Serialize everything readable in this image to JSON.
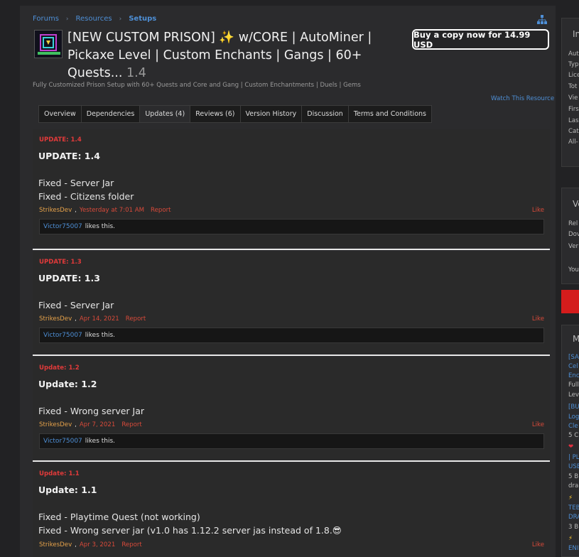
{
  "breadcrumb": {
    "forums": "Forums",
    "resources": "Resources",
    "setups": "Setups"
  },
  "resource": {
    "title": "[NEW CUSTOM PRISON] ✨ w/CORE | AutoMiner | Pickaxe Level | Custom Enchants | Gangs | 60+ Quests...",
    "version": "1.4",
    "tagline": "Fully Customized Prison Setup with 60+ Quests and Core and Gang | Custom Enchantments | Duels | Gems",
    "buy_label": "Buy a copy now for 14.99 USD",
    "watch_label": "Watch This Resource"
  },
  "tabs": [
    {
      "label": "Overview"
    },
    {
      "label": "Dependencies"
    },
    {
      "label": "Updates (4)"
    },
    {
      "label": "Reviews (6)"
    },
    {
      "label": "Version History"
    },
    {
      "label": "Discussion"
    },
    {
      "label": "Terms and Conditions"
    }
  ],
  "updates": [
    {
      "small_title": "UPDATE: 1.4",
      "title": "UPDATE: 1.4",
      "lines": [
        "Fixed - Server Jar",
        "Fixed - Citizens folder"
      ],
      "author": "StrikesDev",
      "date": "Yesterday at 7:01 AM",
      "report": "Report",
      "like": "Like",
      "liker": "Victor75007",
      "likes_text": "likes this."
    },
    {
      "small_title": "UPDATE: 1.3",
      "title": "UPDATE: 1.3",
      "lines": [
        "Fixed - Server Jar"
      ],
      "author": "StrikesDev",
      "date": "Apr 14, 2021",
      "report": "Report",
      "like": "Like",
      "liker": "Victor75007",
      "likes_text": "likes this."
    },
    {
      "small_title": "Update: 1.2",
      "title": "Update: 1.2",
      "lines": [
        "Fixed - Wrong server Jar"
      ],
      "author": "StrikesDev",
      "date": "Apr 7, 2021",
      "report": "Report",
      "like": "Like",
      "liker": "Victor75007",
      "likes_text": "likes this."
    },
    {
      "small_title": "Update: 1.1",
      "title": "Update: 1.1",
      "lines": [
        "Fixed - Playtime Quest (not working)",
        "Fixed - Wrong server jar (v1.0 has 1.12.2 server jas instead of 1.8.😎"
      ],
      "author": "StrikesDev",
      "date": "Apr 3, 2021",
      "report": "Report",
      "like": "Like"
    }
  ],
  "sidebar": {
    "info_head": "In",
    "info_rows": [
      "Aut",
      "Typ",
      "Lice",
      "Tot",
      "Vie",
      "Firs",
      "Las",
      "Cat",
      "All-"
    ],
    "version_head": "Ve",
    "version_rows": [
      "Rel",
      "Dov",
      "Ver",
      "You"
    ],
    "more_head": "M",
    "more_items": [
      {
        "text": "[SA",
        "kind": "link"
      },
      {
        "text": "Cel",
        "kind": "link"
      },
      {
        "text": "Enc",
        "kind": "link"
      },
      {
        "text": "Full",
        "kind": "text"
      },
      {
        "text": "Lev",
        "kind": "text"
      },
      {
        "text": "[BU",
        "kind": "link"
      },
      {
        "text": "Log",
        "kind": "link"
      },
      {
        "text": "Cle",
        "kind": "link"
      },
      {
        "text": "5 C",
        "kind": "text"
      },
      {
        "text": "❤",
        "kind": "heart"
      },
      {
        "text": "| PL",
        "kind": "link"
      },
      {
        "text": "USE",
        "kind": "link"
      },
      {
        "text": "5 B",
        "kind": "text"
      },
      {
        "text": "dra",
        "kind": "text"
      },
      {
        "text": "⚡",
        "kind": "bolt"
      },
      {
        "text": "TEB",
        "kind": "link"
      },
      {
        "text": "DRA",
        "kind": "link"
      },
      {
        "text": "3 B",
        "kind": "text"
      },
      {
        "text": "⚡",
        "kind": "bolt"
      },
      {
        "text": "ENI",
        "kind": "link"
      }
    ]
  },
  "colors": {
    "accent_link": "#4e8fd6",
    "red": "#d84a3a",
    "author": "#e6a24a"
  }
}
